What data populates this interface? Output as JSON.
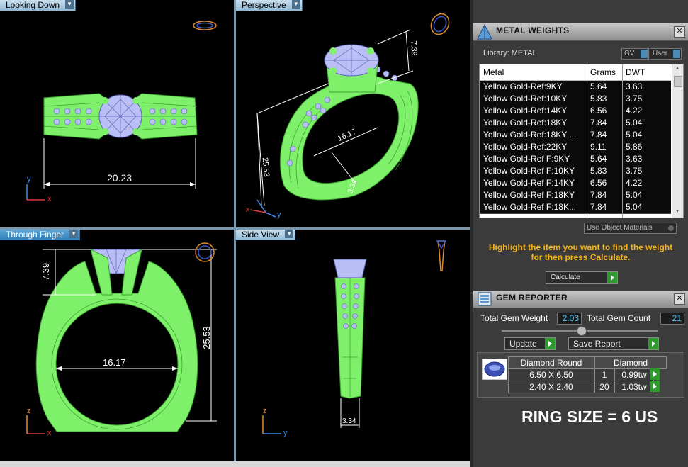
{
  "viewports": {
    "top_left": {
      "label": "Looking Down",
      "dimension": "20.23"
    },
    "top_right": {
      "label": "Perspective",
      "dims": [
        "7.39",
        "16.17",
        "25.53",
        "3.34"
      ]
    },
    "bottom_left": {
      "label": "Through Finger",
      "height_dim": "7.39",
      "total_dim": "25.53",
      "width_dim": "16.17"
    },
    "bottom_right": {
      "label": "Side View",
      "dimension": "3.34"
    }
  },
  "axes": {
    "x": "x",
    "y": "y",
    "z": "z"
  },
  "metal_weights": {
    "title": "METAL WEIGHTS",
    "library_label": "Library: METAL",
    "gv_label": "GV",
    "user_label": "User",
    "columns": [
      "Metal",
      "Grams",
      "DWT"
    ],
    "rows": [
      [
        "Yellow Gold-Ref:9KY",
        "5.64",
        "3.63"
      ],
      [
        "Yellow Gold-Ref:10KY",
        "5.83",
        "3.75"
      ],
      [
        "Yellow Gold-Ref:14KY",
        "6.56",
        "4.22"
      ],
      [
        "Yellow Gold-Ref:18KY",
        "7.84",
        "5.04"
      ],
      [
        "Yellow Gold-Ref:18KY ...",
        "7.84",
        "5.04"
      ],
      [
        "Yellow Gold-Ref:22KY",
        "9.11",
        "5.86"
      ],
      [
        "Yellow Gold-Ref F:9KY",
        "5.64",
        "3.63"
      ],
      [
        "Yellow Gold-Ref F:10KY",
        "5.83",
        "3.75"
      ],
      [
        "Yellow Gold-Ref F:14KY",
        "6.56",
        "4.22"
      ],
      [
        "Yellow Gold-Ref F:18KY",
        "7.84",
        "5.04"
      ],
      [
        "Yellow Gold-Ref F:18K...",
        "7.84",
        "5.04"
      ]
    ],
    "use_object_materials": "Use Object Materials",
    "hint": "Highlight the item you want to find the weight for then press Calculate.",
    "calculate_label": "Calculate"
  },
  "gem_reporter": {
    "title": "GEM REPORTER",
    "total_weight_label": "Total Gem Weight",
    "total_weight": "2.03",
    "total_count_label": "Total Gem Count",
    "total_count": "21",
    "update_label": "Update",
    "save_label": "Save Report",
    "shape_header": "Diamond Round",
    "type_header": "Diamond",
    "gems": [
      {
        "size": "6.50 X 6.50",
        "count": "1",
        "weight": "0.99tw"
      },
      {
        "size": "2.40 X 2.40",
        "count": "20",
        "weight": "1.03tw"
      }
    ]
  },
  "annotation": "RING SIZE = 6 US",
  "colors": {
    "metal": "#7ff06a",
    "gem": "#b9bff5",
    "accent_title": "#f2b418",
    "value_blue": "#4ac6ff"
  }
}
